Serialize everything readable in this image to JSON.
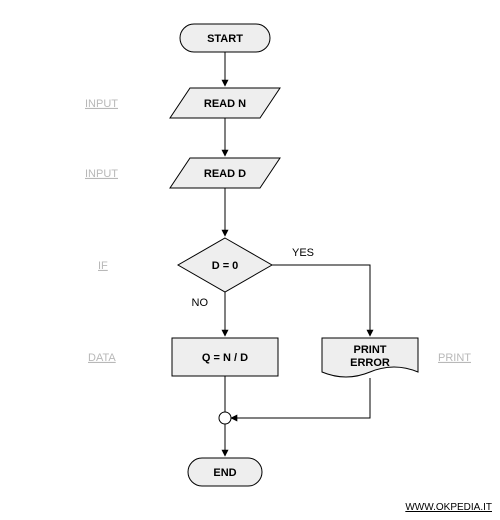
{
  "nodes": {
    "start": "START",
    "read_n": "READ N",
    "read_d": "READ D",
    "decision": "D = 0",
    "compute": "Q = N / D",
    "print_error_l1": "PRINT",
    "print_error_l2": "ERROR",
    "end": "END"
  },
  "side_labels": {
    "input1": "INPUT",
    "input2": "INPUT",
    "if": "IF",
    "data": "DATA",
    "print": "PRINT"
  },
  "edge_labels": {
    "yes": "YES",
    "no": "NO"
  },
  "footer": "WWW.OKPEDIA.IT"
}
